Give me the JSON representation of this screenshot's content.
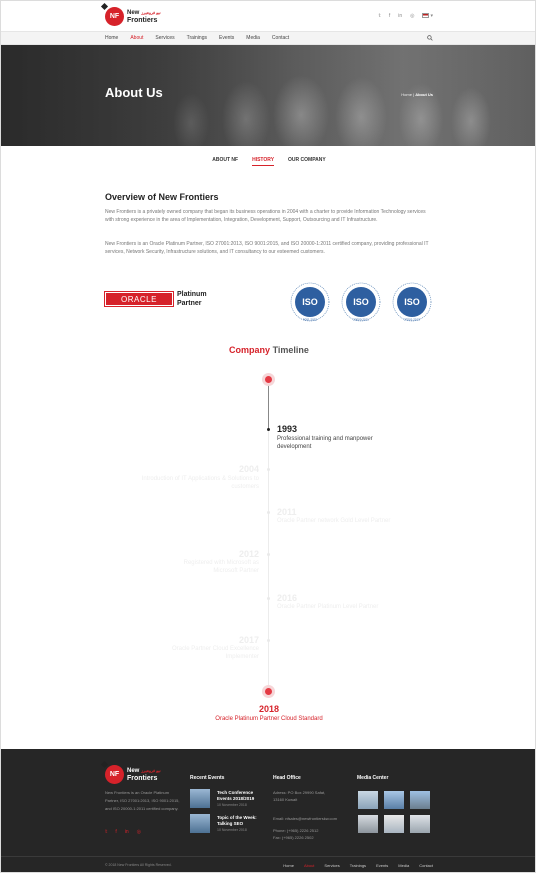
{
  "header": {
    "logo_line1": "New",
    "logo_arabic": "نيو فرونتيرز",
    "logo_line2": "Frontiers",
    "logo_mark": "NF",
    "socials": [
      "twitter-icon",
      "facebook-icon",
      "linkedin-icon",
      "instagram-icon"
    ],
    "social_glyphs": [
      "𝕥",
      "f",
      "in",
      "◎"
    ],
    "lang_caret": "▾"
  },
  "nav": {
    "items": [
      "Home",
      "About",
      "Services",
      "Trainings",
      "Events",
      "Media",
      "Contact"
    ],
    "active": "About"
  },
  "hero": {
    "title": "About Us",
    "breadcrumb_home": "Home",
    "breadcrumb_sep": "|",
    "breadcrumb_current": "About Us"
  },
  "tabs": {
    "items": [
      "ABOUT NF",
      "HISTORY",
      "OUR COMPANY"
    ],
    "active": "HISTORY"
  },
  "overview": {
    "title": "Overview of New Frontiers",
    "p1": "New Frontiers is a privately owned company that began its business operations in 2004 with a charter to provide Information Technology services with strong experience in the area of Implementation, Integration, Development, Support, Outsourcing and IT Infrastructure.",
    "p2": "New Frontiers is an Oracle Platinum Partner, ISO 27001:2013, ISO 9001:2015, and ISO 20000-1:2011 certified company, providing professional IT services, Network Security, Infrastructure solutions, and IT consultancy to our esteemed customers."
  },
  "partners": {
    "oracle": "ORACLE",
    "oracle_sub1": "Platinum",
    "oracle_sub2": "Partner",
    "iso": [
      {
        "label": "ISO",
        "code": "9001:2015"
      },
      {
        "label": "ISO",
        "code": "20000:2011"
      },
      {
        "label": "ISO",
        "code": "27001:2013"
      }
    ]
  },
  "timeline": {
    "title_a": "Company",
    "title_b": "Timeline",
    "events": [
      {
        "year": "1993",
        "desc": "Professional training and manpower development",
        "side": "right"
      },
      {
        "year": "2004",
        "desc": "Introduction of IT Applications & Solutions to customers",
        "side": "left"
      },
      {
        "year": "2011",
        "desc": "Oracle Partner network Gold Level Partner",
        "side": "right"
      },
      {
        "year": "2012",
        "desc": "Registered with Microsoft as Microsoft Partner",
        "side": "left"
      },
      {
        "year": "2016",
        "desc": "Oracle Partner Platinum Level Partner",
        "side": "right"
      },
      {
        "year": "2017",
        "desc": "Oracle Partner Cloud Excellence Implementer",
        "side": "left"
      },
      {
        "year": "2018",
        "desc": "Oracle Platinum Partner Cloud Standard",
        "side": "center"
      }
    ]
  },
  "footer": {
    "about": "New Frontiers is an Oracle Platinum Partner, ISO 27001:2013, ISO 9001:2015, and ISO 20000-1:2011 certified company.",
    "recent_events_title": "Recent Events",
    "events": [
      {
        "title": "Tech Conference Events 2018/2019",
        "date": "10 November 2018"
      },
      {
        "title": "Topic of the Week: Talking SEO",
        "date": "10 November 2018"
      }
    ],
    "head_office_title": "Head Office",
    "address": "Adress: PO Box 29990 Safat, 13160 Kuwait",
    "email": "Email: nfsales@newfrontierskw.com",
    "phone": "Phone: (+965) 2226 2512",
    "fax": "Fax: (+965) 2226 2502",
    "media_center_title": "Media Center",
    "copyright": "© 2018 New Frontiers All Rights Reserved.",
    "nav": [
      "Home",
      "About",
      "Services",
      "Trainings",
      "Events",
      "Media",
      "Contact"
    ],
    "nav_active": "About"
  },
  "colors": {
    "brand_red": "#d6222a",
    "footer_bg": "#262626",
    "timeline_dot": "#e43a44"
  }
}
